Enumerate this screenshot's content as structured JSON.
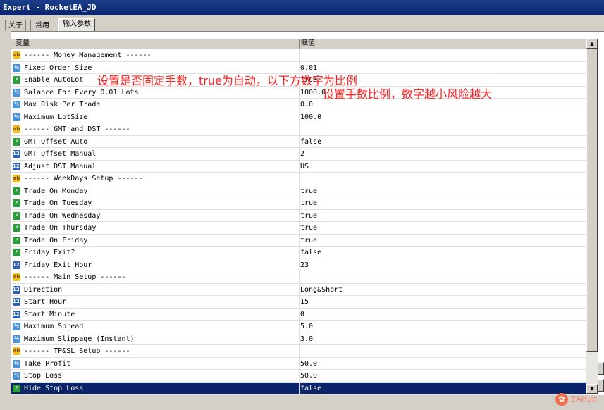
{
  "window": {
    "title": "Expert - RocketEA_JD"
  },
  "tabs": [
    {
      "label": "关于"
    },
    {
      "label": "常用"
    },
    {
      "label": "输入参数"
    }
  ],
  "table": {
    "headers": {
      "variable": "变量",
      "value": "赋值"
    },
    "rows": [
      {
        "type": "ab",
        "name": "------ Money Management ------",
        "value": ""
      },
      {
        "type": "dbl",
        "name": "Fixed Order Size",
        "value": "0.01"
      },
      {
        "type": "bool",
        "name": "Enable AutoLot",
        "value": "true"
      },
      {
        "type": "dbl",
        "name": "Balance For Every 0.01 Lots",
        "value": "1000.0"
      },
      {
        "type": "dbl",
        "name": "Max Risk Per Trade",
        "value": "0.0"
      },
      {
        "type": "dbl",
        "name": "Maximum LotSize",
        "value": "100.0"
      },
      {
        "type": "ab",
        "name": "------ GMT and DST ------",
        "value": ""
      },
      {
        "type": "bool",
        "name": "GMT Offset Auto",
        "value": "false"
      },
      {
        "type": "int",
        "name": "GMT Offset Manual",
        "value": "2"
      },
      {
        "type": "int",
        "name": "Adjust DST Manual",
        "value": "US"
      },
      {
        "type": "ab",
        "name": "------ WeekDays Setup ------",
        "value": ""
      },
      {
        "type": "bool",
        "name": "Trade On Monday",
        "value": "true"
      },
      {
        "type": "bool",
        "name": "Trade On Tuesday",
        "value": "true"
      },
      {
        "type": "bool",
        "name": "Trade On Wednesday",
        "value": "true"
      },
      {
        "type": "bool",
        "name": "Trade On Thursday",
        "value": "true"
      },
      {
        "type": "bool",
        "name": "Trade On Friday",
        "value": "true"
      },
      {
        "type": "bool",
        "name": "Friday Exit?",
        "value": "false"
      },
      {
        "type": "int",
        "name": "Friday Exit Hour",
        "value": "23"
      },
      {
        "type": "ab",
        "name": "------ Main Setup ------",
        "value": ""
      },
      {
        "type": "int",
        "name": "Direction",
        "value": "Long&Short"
      },
      {
        "type": "int",
        "name": "Start Hour",
        "value": "15"
      },
      {
        "type": "int",
        "name": "Start Minute",
        "value": "0"
      },
      {
        "type": "dbl",
        "name": "Maximum Spread",
        "value": "5.0"
      },
      {
        "type": "dbl",
        "name": "Maximum Slippage (Instant)",
        "value": "3.0"
      },
      {
        "type": "ab",
        "name": "------ TP&SL Setup ------",
        "value": ""
      },
      {
        "type": "dbl",
        "name": "Take Profit",
        "value": "50.0"
      },
      {
        "type": "dbl",
        "name": "Stop Loss",
        "value": "50.0"
      },
      {
        "type": "bool",
        "name": "Hide Stop Loss",
        "value": "false",
        "selected": true
      }
    ]
  },
  "annotations": {
    "autolot_note": "设置是否固定手数，true为自动，以下方数字为比例",
    "ratio_note": "设置手数比例，数字越小风险越大"
  },
  "watermark": {
    "text": "EAHub"
  },
  "icons": {
    "ab": "ab",
    "dbl": "½",
    "bool": "↗",
    "int": "123"
  },
  "colors": {
    "title_bar": "#0a246a",
    "selection": "#0a246a",
    "annotation": "#ff2020"
  }
}
